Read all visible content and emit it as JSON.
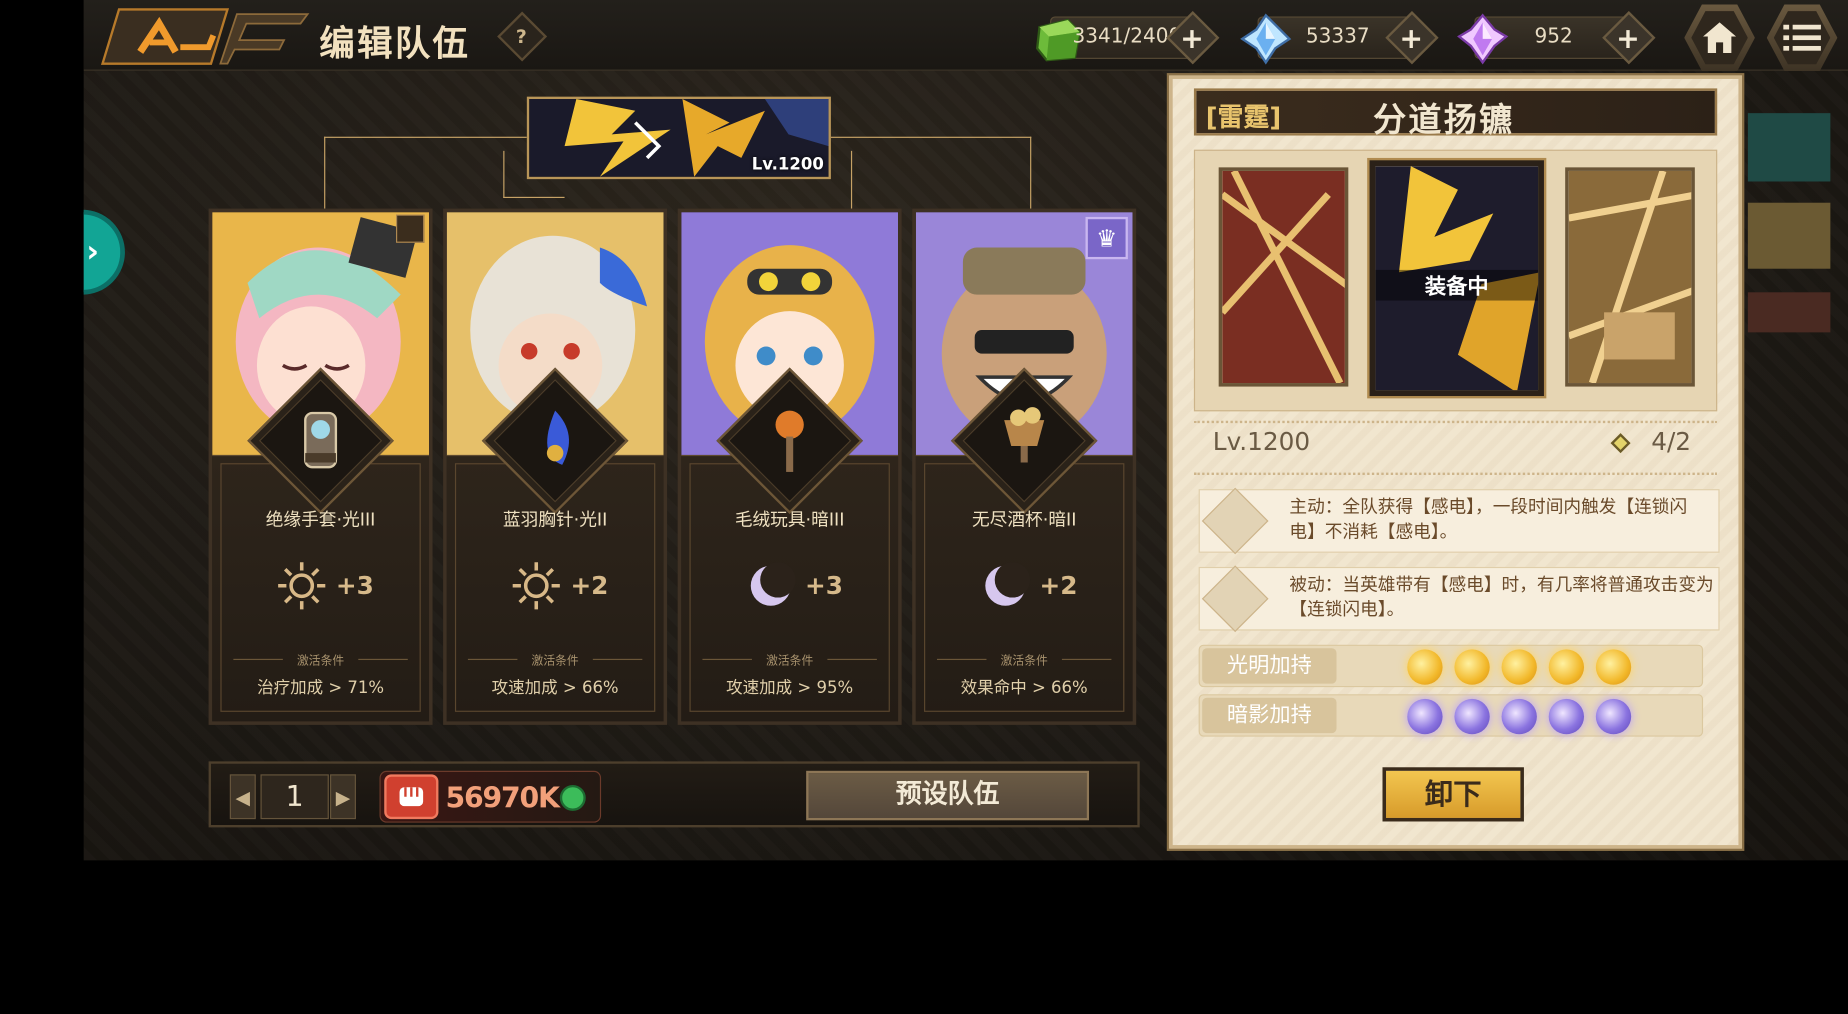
{
  "header": {
    "title": "编辑队伍",
    "help": "?",
    "resources": [
      {
        "icon": "green-cube-gem-icon",
        "value": "3341/2400"
      },
      {
        "icon": "blue-crystal-icon",
        "value": "53337"
      },
      {
        "icon": "purple-crystal-icon",
        "value": "952"
      }
    ],
    "plus": "+"
  },
  "relic_top": {
    "level": "Lv.1200"
  },
  "heroes": [
    {
      "equip_name": "绝缘手套·光III",
      "attr_icon": "sun-icon",
      "attr_value": "+3",
      "cond_label": "激活条件",
      "condition": "治疗加成 > 71%"
    },
    {
      "equip_name": "蓝羽胸针·光II",
      "attr_icon": "sun-icon",
      "attr_value": "+2",
      "cond_label": "激活条件",
      "condition": "攻速加成 > 66%"
    },
    {
      "equip_name": "毛绒玩具·暗III",
      "attr_icon": "moon-icon",
      "attr_value": "+3",
      "cond_label": "激活条件",
      "condition": "攻速加成 > 95%"
    },
    {
      "equip_name": "无尽酒杯·暗II",
      "attr_icon": "moon-icon",
      "attr_value": "+2",
      "cond_label": "激活条件",
      "condition": "效果命中 > 66%"
    }
  ],
  "bottom": {
    "page_prev": "◀",
    "page": "1",
    "page_next": "▶",
    "power": "56970K",
    "preset_label": "预设队伍"
  },
  "relic_panel": {
    "type": "[雷霆]",
    "name": "分道扬镳",
    "equipped_tag": "装备中",
    "level": "Lv.1200",
    "count": "4/2",
    "active_skill": "主动：全队获得【感电】，一段时间内触发【连锁闪电】不消耗【感电】。",
    "passive_skill": "被动：当英雄带有【感电】时，有几率将普通攻击变为【连锁闪电】。",
    "light_label": "光明加持",
    "dark_label": "暗影加持",
    "light_orbs": 5,
    "dark_orbs": 5,
    "unequip_label": "卸下"
  }
}
